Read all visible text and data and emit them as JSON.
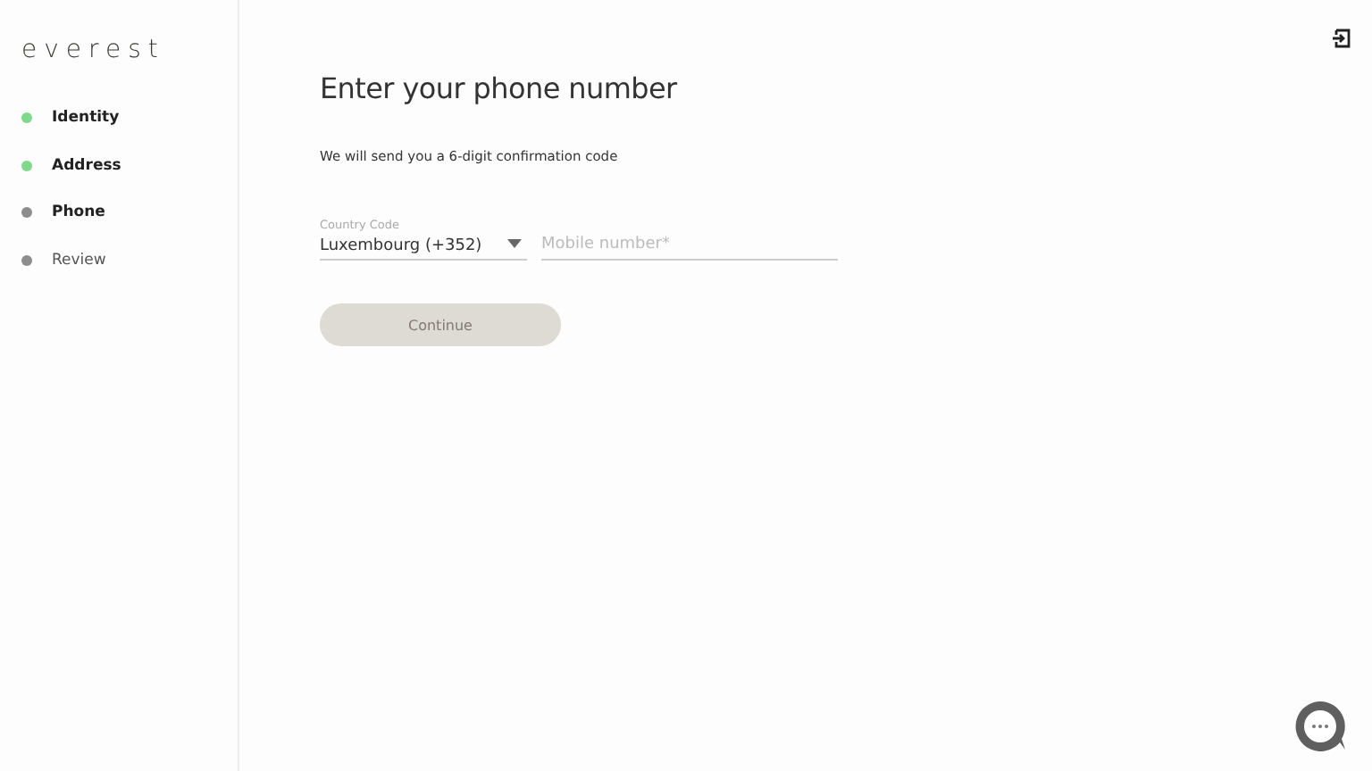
{
  "sidebar": {
    "logo": "everest",
    "steps": [
      {
        "label": "Identity",
        "done": true,
        "reached": true
      },
      {
        "label": "Address",
        "done": true,
        "reached": true
      },
      {
        "label": "Phone",
        "done": false,
        "reached": true
      },
      {
        "label": "Review",
        "done": false,
        "reached": false
      }
    ]
  },
  "main": {
    "title": "Enter your phone number",
    "subtitle": "We will send you a 6-digit confirmation code",
    "country": {
      "label": "Country Code",
      "value": "Luxembourg (+352)"
    },
    "mobile": {
      "placeholder": "Mobile number*"
    },
    "continue_button": {
      "label": "Continue",
      "disabled": true
    }
  }
}
